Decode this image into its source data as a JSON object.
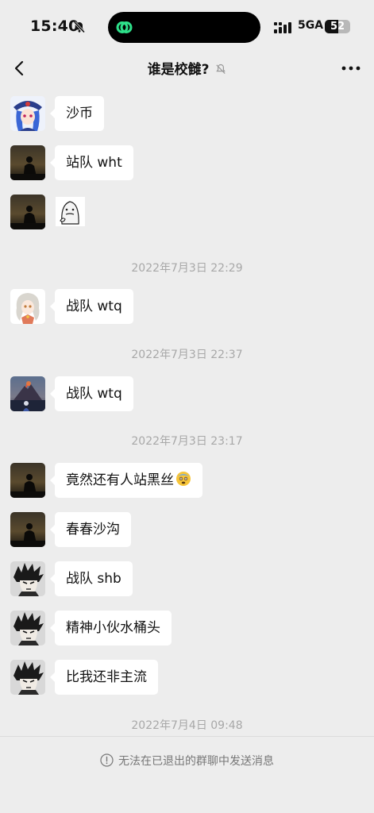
{
  "status_bar": {
    "time": "15:40",
    "network": "5GA",
    "battery_level": "52",
    "battery_fraction": 0.52
  },
  "header": {
    "title": "谁是校雠?",
    "back_icon": "chevron-left-icon",
    "more_icon": "more-dots-icon",
    "mute_icon": "bell-slash-icon"
  },
  "messages": [
    {
      "avatar": "anime-girl-blue-hat",
      "text": "沙币"
    },
    {
      "avatar": "dark-silhouette",
      "text": "站队 wht"
    },
    {
      "avatar": "dark-silhouette",
      "sticker": "meme-face-sticker"
    },
    {
      "timestamp": "2022年7月3日 22:29"
    },
    {
      "avatar": "anime-girl-silver-hair",
      "text": "战队 wtq"
    },
    {
      "timestamp": "2022年7月3日 22:37"
    },
    {
      "avatar": "volcano-scene",
      "text": "战队 wtq"
    },
    {
      "timestamp": "2022年7月3日 23:17"
    },
    {
      "avatar": "dark-silhouette",
      "text": "竟然还有人站黑丝",
      "emoji": "sweat-face-emoji"
    },
    {
      "avatar": "dark-silhouette",
      "text": "春春沙沟"
    },
    {
      "avatar": "manga-spiky-hair",
      "text": "战队 shb"
    },
    {
      "avatar": "manga-spiky-hair",
      "text": "精神小伙水桶头"
    },
    {
      "avatar": "manga-spiky-hair",
      "text": "比我还非主流"
    },
    {
      "timestamp": "2022年7月4日 09:48"
    }
  ],
  "footer": {
    "notice": "无法在已退出的群聊中发送消息",
    "notice_icon": "info-circle-icon"
  },
  "colors": {
    "background": "#ededed",
    "bubble": "#ffffff",
    "timestamp": "#a8a8a8",
    "island_accent": "#2ee08a"
  }
}
